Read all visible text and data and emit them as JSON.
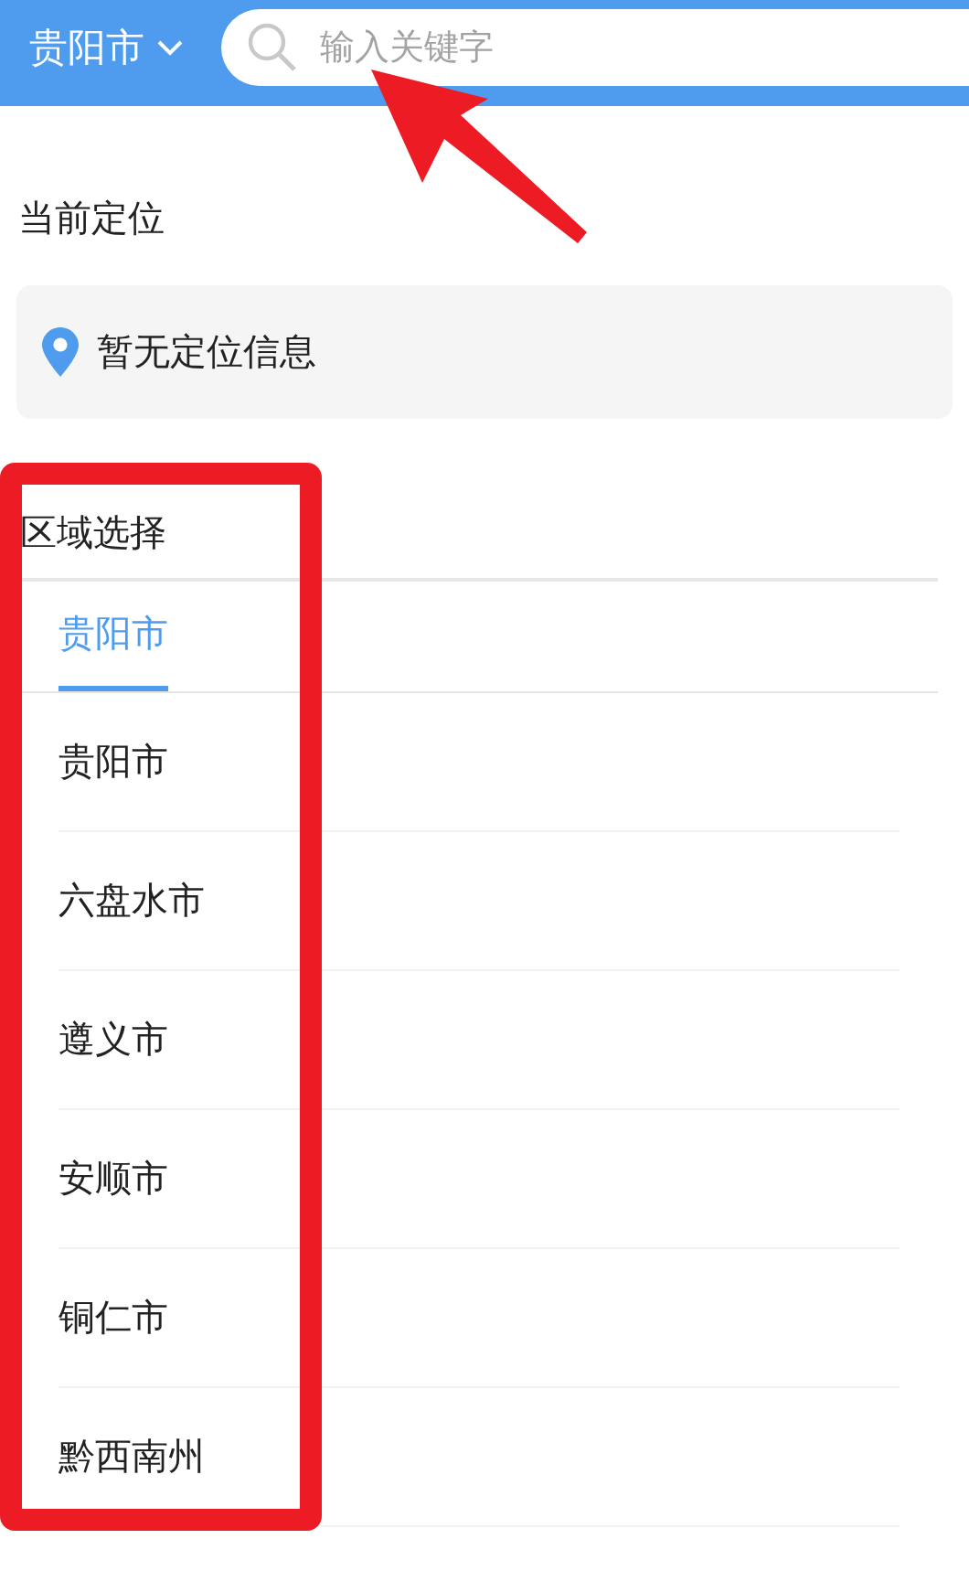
{
  "header": {
    "city": "贵阳市",
    "search": {
      "placeholder": "输入关键字"
    }
  },
  "current_location": {
    "title": "当前定位",
    "status": "暂无定位信息"
  },
  "region_select": {
    "title": "区域选择",
    "tabs": [
      {
        "label": "贵阳市",
        "selected": true
      }
    ],
    "items": [
      "贵阳市",
      "六盘水市",
      "遵义市",
      "安顺市",
      "铜仁市",
      "黔西南州"
    ]
  }
}
